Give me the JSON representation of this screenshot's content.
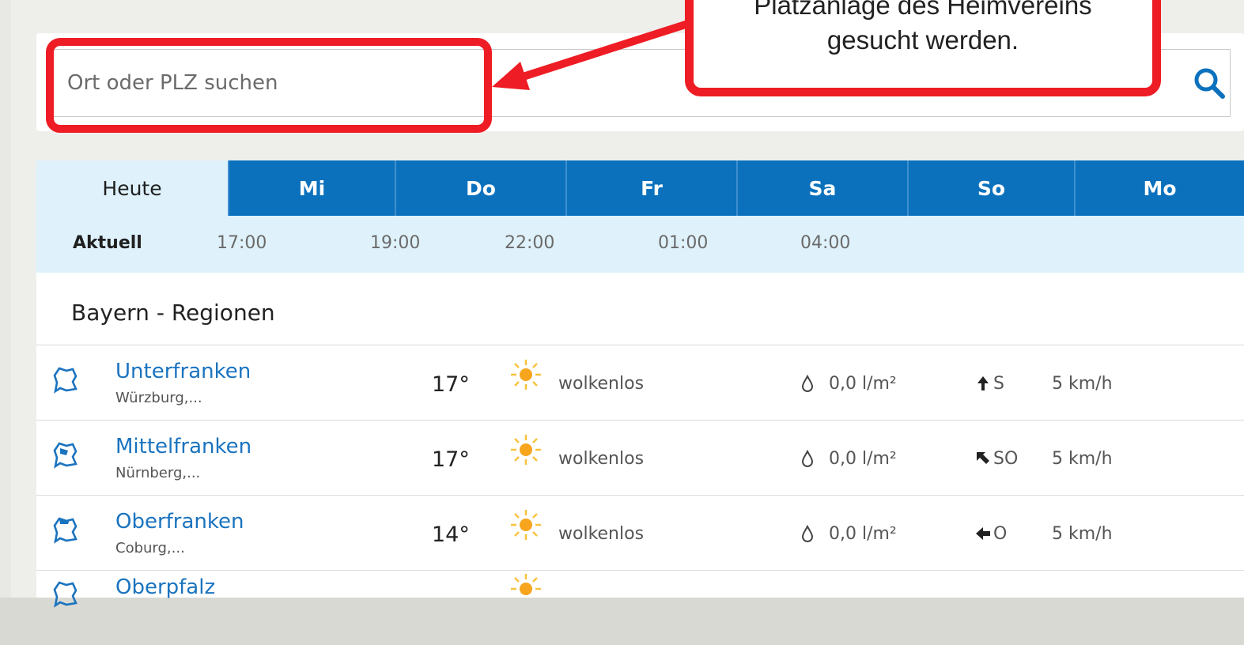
{
  "search": {
    "placeholder": "Ort oder PLZ suchen"
  },
  "tabs": [
    {
      "label": "Heute",
      "active": true
    },
    {
      "label": "Mi"
    },
    {
      "label": "Do"
    },
    {
      "label": "Fr"
    },
    {
      "label": "Sa"
    },
    {
      "label": "So"
    },
    {
      "label": "Mo"
    }
  ],
  "hours": [
    "Aktuell",
    "17:00",
    "19:00",
    "22:00",
    "01:00",
    "04:00"
  ],
  "section": {
    "title": "Bayern - Regionen"
  },
  "rows": [
    {
      "name": "Unterfranken",
      "cities": "Würzburg,...",
      "temp": "17°",
      "condition": "wolkenlos",
      "rain": "0,0 l/m²",
      "wind_dir": "S",
      "wind_speed": "5 km/h",
      "wind_icon": "arrow-up-icon"
    },
    {
      "name": "Mittelfranken",
      "cities": "Nürnberg,...",
      "temp": "17°",
      "condition": "wolkenlos",
      "rain": "0,0 l/m²",
      "wind_dir": "SO",
      "wind_speed": "5 km/h",
      "wind_icon": "arrow-up-left-icon"
    },
    {
      "name": "Oberfranken",
      "cities": "Coburg,...",
      "temp": "14°",
      "condition": "wolkenlos",
      "rain": "0,0 l/m²",
      "wind_dir": "O",
      "wind_speed": "5 km/h",
      "wind_icon": "arrow-left-icon"
    },
    {
      "name": "Oberpfalz",
      "cities": "",
      "temp": "",
      "condition": "",
      "rain": "",
      "wind_dir": "",
      "wind_speed": "",
      "wind_icon": ""
    }
  ],
  "annotation": {
    "line1": "Platzanlage des Heimvereins",
    "line2": "gesucht werden.",
    "color": "#ee1c24"
  },
  "colors": {
    "accent": "#0b71bd",
    "tab_active_bg": "#dff2fb",
    "link": "#1a73bf"
  }
}
